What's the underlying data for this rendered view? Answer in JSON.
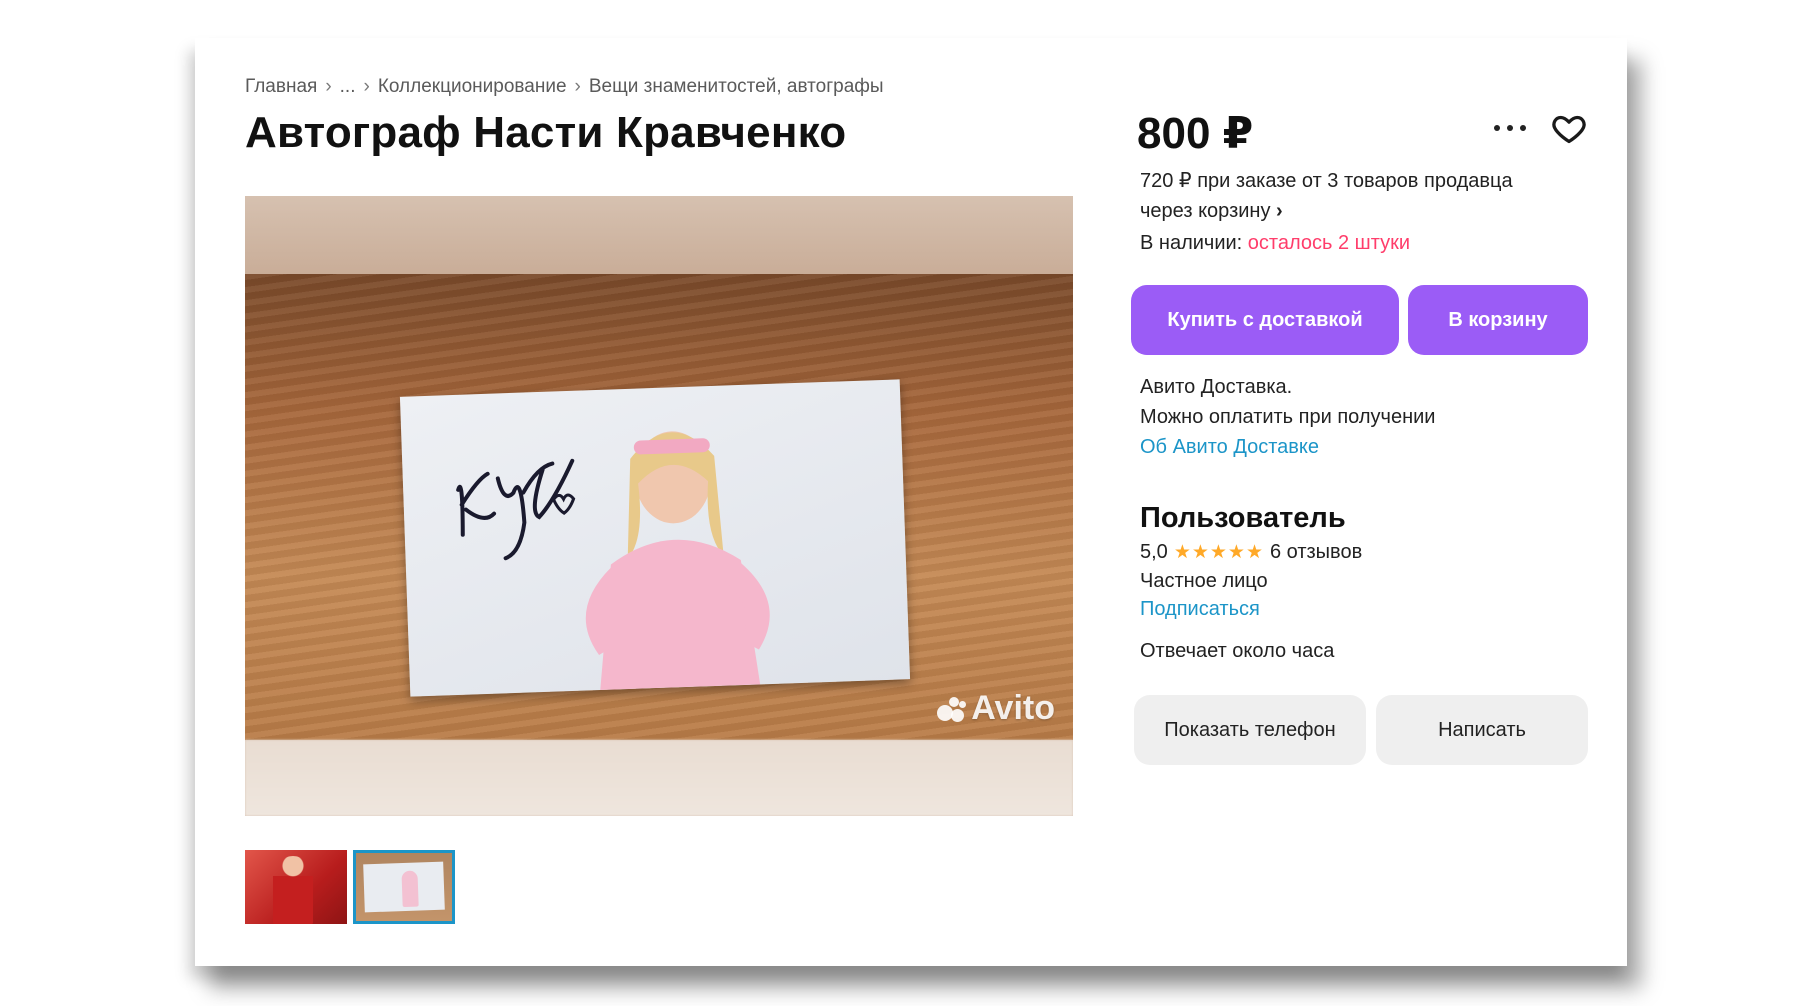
{
  "breadcrumb": {
    "items": [
      "Главная",
      "...",
      "Коллекционирование",
      "Вещи знаменитостей, автографы"
    ],
    "separator": "›"
  },
  "listing": {
    "title": "Автограф Насти Кравченко",
    "watermark": "Avito",
    "signature_text": "Кру"
  },
  "thumbnails": {
    "count": 2,
    "selected_index": 1
  },
  "price": {
    "value": "800 ₽",
    "bulk_line1": "720 ₽ при заказе от 3 товаров продавца",
    "bulk_line2": "через корзину",
    "bulk_chevron": "›"
  },
  "stock": {
    "label": "В наличии: ",
    "value": "осталось 2 штуки",
    "value_color": "#ff3d6b"
  },
  "actions": {
    "buy_label": "Купить с доставкой",
    "cart_label": "В корзину",
    "accent_color": "#9b5cf6"
  },
  "delivery": {
    "line1": "Авито Доставка.",
    "line2": "Можно оплатить при получении",
    "link": "Об Авито Доставке",
    "link_color": "#1c95c8"
  },
  "seller": {
    "name": "Пользователь",
    "rating": "5,0",
    "stars": "★★★★★",
    "reviews": "6 отзывов",
    "type": "Частное лицо",
    "subscribe": "Подписаться",
    "reply_time": "Отвечает около часа"
  },
  "contact": {
    "phone_label": "Показать телефон",
    "message_label": "Написать"
  },
  "icons": {
    "more": "more-icon",
    "favorite": "heart-icon"
  }
}
